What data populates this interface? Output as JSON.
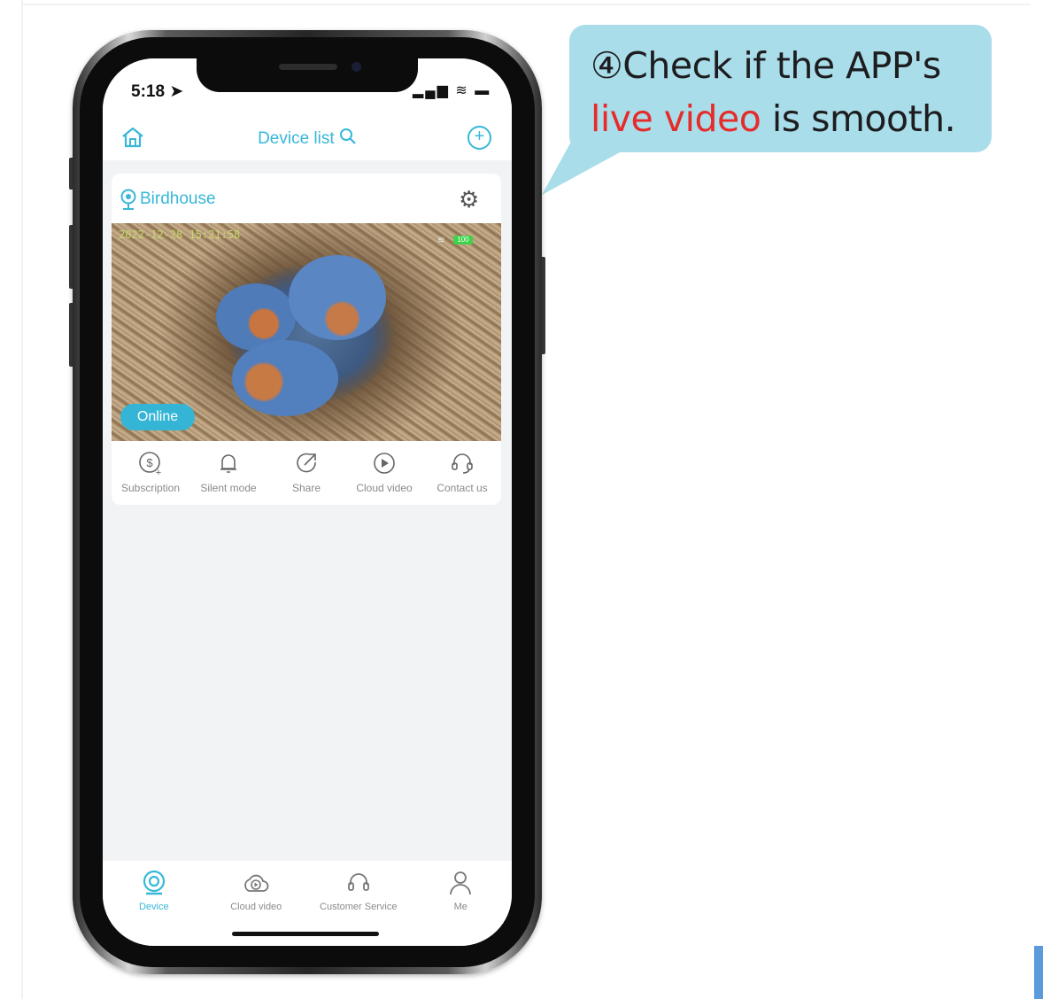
{
  "callout": {
    "line1": "④Check if the APP's",
    "line2_highlight": "live video",
    "line2_rest": " is smooth.",
    "bg_color": "#a9dde9",
    "highlight_color": "#e62b2b"
  },
  "status_bar": {
    "time": "5:18",
    "icons": "▂▄▆ ≋ ▬"
  },
  "nav": {
    "title": "Device list",
    "home_icon": "home-icon",
    "search_icon": "search-icon",
    "add_icon": "plus-circle-icon",
    "accent_color": "#38b7d8"
  },
  "device": {
    "name": "Birdhouse",
    "timestamp": "2022-12-28 15:21:58",
    "battery": "100",
    "status": "Online"
  },
  "actions": [
    {
      "label": "Subscription",
      "icon": "dollar-plus-icon"
    },
    {
      "label": "Silent mode",
      "icon": "bell-icon"
    },
    {
      "label": "Share",
      "icon": "share-icon"
    },
    {
      "label": "Cloud video",
      "icon": "play-circle-icon"
    },
    {
      "label": "Contact us",
      "icon": "headset-icon"
    }
  ],
  "tabs": [
    {
      "label": "Device",
      "icon": "camera-icon",
      "active": true
    },
    {
      "label": "Cloud video",
      "icon": "cloud-play-icon",
      "active": false
    },
    {
      "label": "Customer Service",
      "icon": "headset-icon",
      "active": false
    },
    {
      "label": "Me",
      "icon": "person-icon",
      "active": false
    }
  ]
}
